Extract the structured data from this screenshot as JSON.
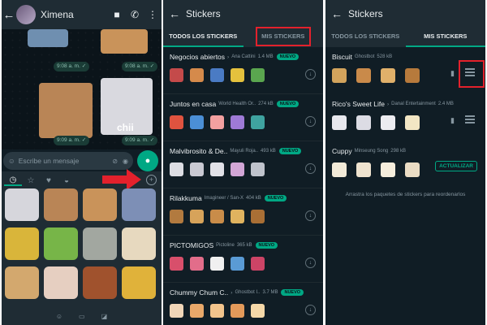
{
  "chat": {
    "contact_name": "Ximena",
    "back_icon": "arrow-left-icon",
    "time_labels": [
      "9:08 a. m. ✓",
      "9:08 a. m. ✓",
      "9:09 a. m. ✓",
      "9:09 a. m. ✓"
    ],
    "sticker_caption": "chii",
    "input_placeholder": "Escribe un mensaje",
    "tray_tabs": [
      "recent-icon",
      "star-icon",
      "heart-icon",
      "cup-icon"
    ],
    "colors": {
      "accent": "#00a884",
      "highlight": "#e3212c"
    }
  },
  "store": {
    "title": "Stickers",
    "tab_all": "TODOS LOS STICKERS",
    "tab_mine": "MIS STICKERS",
    "new_badge": "NUEVO",
    "packs": [
      {
        "name": "Negocios abiertos",
        "author": "Ana Cattini",
        "size": "1.4 MB",
        "is_new": true
      },
      {
        "name": "Juntos en casa",
        "author": "World Health Or..",
        "size": "274 kB",
        "is_new": true
      },
      {
        "name": "Malvibrosito & De..",
        "author": "Mayuli Roja..",
        "size": "493 kB",
        "is_new": true
      },
      {
        "name": "Rilakkuma",
        "author": "Imagineer / San-X",
        "size": "404 kB",
        "is_new": true
      },
      {
        "name": "PICTOMIGOS",
        "author": "Pictoline",
        "size": "365 kB",
        "is_new": true
      },
      {
        "name": "Chummy Chum C..",
        "author": "Ghostbot I..",
        "size": "3.7 MB",
        "is_new": true
      }
    ]
  },
  "mine": {
    "packs": [
      {
        "name": "Biscuit",
        "author": "Ghostbot",
        "size": "528 kB"
      },
      {
        "name": "Rico's Sweet Life",
        "author": "Danal Entertainment",
        "size": "2.4 MB"
      },
      {
        "name": "Cuppy",
        "author": "Minseung Song",
        "size": "298 kB",
        "action": "ACTUALIZAR"
      }
    ],
    "hint": "Arrastra los paquetes de stickers para reordenarlos"
  }
}
